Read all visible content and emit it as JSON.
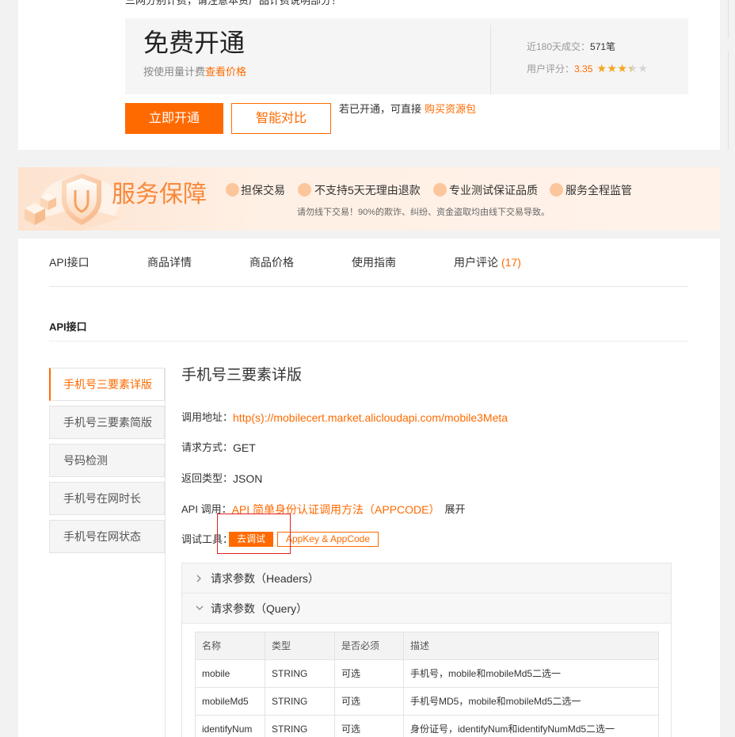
{
  "top": {
    "notice": "三网分别计费，请注意本资产品计费说明部分！",
    "plan": {
      "title": "免费开通",
      "billing": "按使用量计费",
      "price_link": "查看价格"
    },
    "stats": {
      "deals_label": "近180天成交：",
      "deals_value": "571笔",
      "rating_label": "用户评分：",
      "rating_value": "3.35"
    },
    "actions": {
      "open_label": "立即开通",
      "compare_label": "智能对比",
      "hint": "若已开通，可直接",
      "buy_link": "购买资源包"
    }
  },
  "guarantee": {
    "title": "服务保障",
    "items": [
      {
        "label": "担保交易"
      },
      {
        "label": "不支持5天无理由退款"
      },
      {
        "label": "专业测试保证品质"
      },
      {
        "label": "服务全程监管"
      }
    ],
    "warning": "请勿线下交易！90%的欺诈、纠纷、资金盗取均由线下交易导致。"
  },
  "tabs": [
    {
      "label": "API接口"
    },
    {
      "label": "商品详情"
    },
    {
      "label": "商品价格"
    },
    {
      "label": "使用指南"
    },
    {
      "label": "用户评论",
      "count": "(17)"
    }
  ],
  "section_title": "API接口",
  "sidebar": {
    "selected": 0,
    "items": [
      {
        "label": "手机号三要素详版"
      },
      {
        "label": "手机号三要素简版"
      },
      {
        "label": "号码检测"
      },
      {
        "label": "手机号在网时长"
      },
      {
        "label": "手机号在网状态"
      }
    ]
  },
  "api": {
    "title": "手机号三要素详版",
    "endpoint_label": "调用地址：",
    "endpoint": "http(s)://mobilecert.market.alicloudapi.com/mobile3Meta",
    "method_label": "请求方式：",
    "method": "GET",
    "return_label": "返回类型：",
    "return_type": "JSON",
    "auth_label": "API 调用：",
    "auth_link": "API 简单身份认证调用方法（APPCODE）",
    "auth_expand": "展开",
    "debug_label": "调试工具：",
    "debug_button": "去调试",
    "appkey_button": "AppKey & AppCode"
  },
  "params": {
    "headers_title": "请求参数（Headers）",
    "query_title": "请求参数（Query）",
    "columns": [
      "名称",
      "类型",
      "是否必须",
      "描述"
    ],
    "rows": [
      [
        "mobile",
        "STRING",
        "可选",
        "手机号，mobile和mobileMd5二选一"
      ],
      [
        "mobileMd5",
        "STRING",
        "可选",
        "手机号MD5，mobile和mobileMd5二选一"
      ],
      [
        "identifyNum",
        "STRING",
        "可选",
        "身份证号，identifyNum和identifyNumMd5二选一"
      ]
    ]
  },
  "colors": {
    "accent": "#ff6a00",
    "highlight": "#e02020",
    "banner_text": "#f9883a",
    "star": "#f7a51d"
  },
  "icons": {
    "rating": "star-icon",
    "collapsed": "chevron-right-icon",
    "expanded": "chevron-down-icon",
    "bullet": "bullet-dot-icon",
    "banner": "shield-icon"
  }
}
